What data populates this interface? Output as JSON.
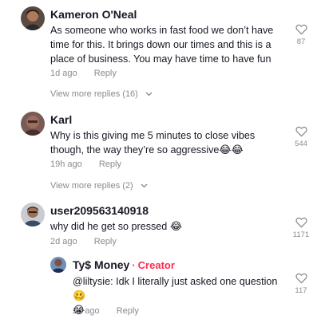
{
  "comments": [
    {
      "username": "Kameron O'Neal",
      "text": "As someone who works in fast food we don’t have time for this. It brings down our times and this is a place of business. You may have time to have fun",
      "time": "1d ago",
      "reply_label": "Reply",
      "likes": "87",
      "view_more": "View more replies (16)"
    },
    {
      "username": "Karl",
      "text": "Why is this giving me 5 minutes to close vibes though, the way they’re so aggressive",
      "emoji": "😂😂",
      "time": "19h ago",
      "reply_label": "Reply",
      "likes": "544",
      "view_more": "View more replies (2)"
    },
    {
      "username": "user209563140918",
      "text": "why did he get so pressed",
      "emoji": "😂",
      "time": "2d ago",
      "reply_label": "Reply",
      "likes": "1171"
    },
    {
      "username": "Ty$ Money",
      "dot": "·",
      "creator_label": "Creator",
      "text": "@liltysie:  Idk I literally just asked one question",
      "emoji_1": "🥴",
      "emoji_2": "😭",
      "time": "2d ago",
      "reply_label": "Reply",
      "likes": "117"
    }
  ],
  "icons": {
    "heart": "heart-outline-icon",
    "chevron": "chevron-down-icon"
  },
  "colors": {
    "text": "#161823",
    "secondary": "#8a8b91",
    "creator": "#fe2c55"
  }
}
